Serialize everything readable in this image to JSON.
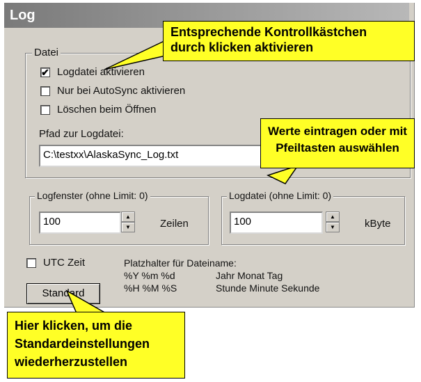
{
  "window": {
    "title": "Log"
  },
  "file_group": {
    "legend": "Datei",
    "checkboxes": [
      {
        "label": "Logdatei aktivieren",
        "checked": true,
        "mark": "✔"
      },
      {
        "label": "Nur bei AutoSync aktivieren",
        "checked": false,
        "mark": ""
      },
      {
        "label": "Löschen beim Öffnen",
        "checked": false,
        "mark": ""
      }
    ],
    "path_label": "Pfad zur Logdatei:",
    "path_value": "C:\\testxx\\AlaskaSync_Log.txt",
    "browse_label": "..."
  },
  "logwindow_group": {
    "legend": "Logfenster (ohne Limit: 0)",
    "value": "100",
    "unit": "Zeilen"
  },
  "logfile_group": {
    "legend": "Logdatei (ohne Limit: 0)",
    "value": "100",
    "unit": "kByte"
  },
  "utc": {
    "label": "UTC Zeit",
    "checked": false
  },
  "standard_button": {
    "label": "Standard"
  },
  "placeholders": {
    "heading": "Platzhalter für Dateiname:",
    "row1_codes": "%Y %m %d",
    "row1_meaning": "Jahr Monat Tag",
    "row2_codes": "%H %M %S",
    "row2_meaning": "Stunde Minute Sekunde"
  },
  "callouts": {
    "checkboxes_line1": "Entsprechende Kontrollkästchen",
    "checkboxes_line2": "durch klicken aktivieren",
    "values_line1": "Werte eintragen oder mit",
    "values_line2": "Pfeiltasten auswählen",
    "standard_line1": "Hier klicken, um die",
    "standard_line2": "Standardeinstellungen",
    "standard_line3": "wiederherzustellen"
  },
  "colors": {
    "panel": "#d4d0c8",
    "callout": "#ffff26",
    "titlebar": "#8a8a8a"
  }
}
